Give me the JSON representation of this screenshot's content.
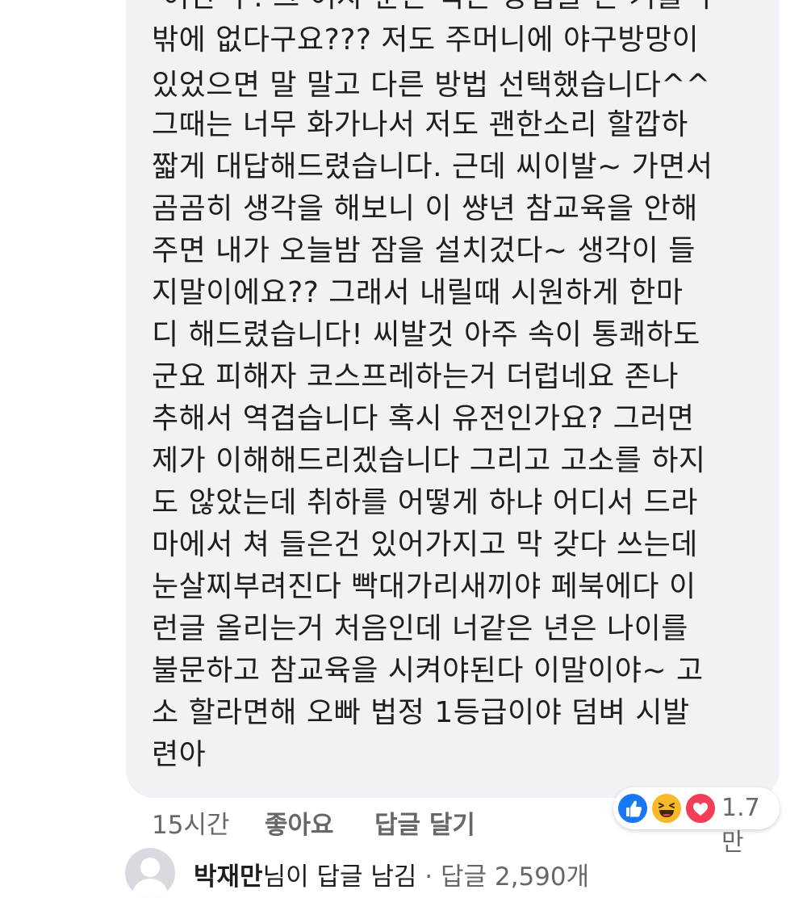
{
  "comment": {
    "partial_first_line": "-어난 누. 그 여자 분은 직는 방법을 쓴 거를 수",
    "lines": [
      "밖에 없다구요??? 저도 주머니에 야구방망이",
      "있었으면 말 말고 다른 방법 선택했습니다^^",
      "그때는 너무 화가나서 저도 괜한소리 할깝하",
      "짧게 대답해드렸습니다. 근데 씨이발~ 가면서",
      "곰곰히 생각을 해보니 이 썅년 참교육을 안해",
      "주면 내가 오늘밤 잠을 설치겄다~ 생각이 들",
      "지말이에요?? 그래서 내릴때 시원하게 한마",
      "디 해드렸습니다! 씨발것 아주 속이 통쾌하도",
      "군요 피해자 코스프레하는거 더럽네요 존나",
      "추해서 역겹습니다 혹시 유전인가요? 그러면",
      "제가 이해해드리겠습니다 그리고 고소를 하지",
      "도 않았는데 취하를 어떻게 하냐 어디서 드라",
      "마에서 쳐 들은건 있어가지고 막 갖다 쓰는데",
      "눈살찌부려진다 빡대가리새끼야 페북에다 이",
      "런글 올리는거 처음인데 너같은 년은 나이를",
      "불문하고 참교육을 시켜야된다 이말이야~ 고",
      "소 할라면해 오빠 법정 1등급이야 덤벼 시발",
      "련아"
    ]
  },
  "actions": {
    "time": "15시간",
    "like": "좋아요",
    "reply": "답글 달기"
  },
  "reactions": {
    "count": "1.7만",
    "icons": [
      "like-icon",
      "haha-icon",
      "love-icon"
    ],
    "colors": {
      "like": "#1877f2",
      "haha": "#f7b928",
      "love": "#f33e58"
    }
  },
  "reply_summary": {
    "name": "박재만",
    "text": "님이 답글 남김",
    "separator": "·",
    "count": "답글 2,590개"
  }
}
